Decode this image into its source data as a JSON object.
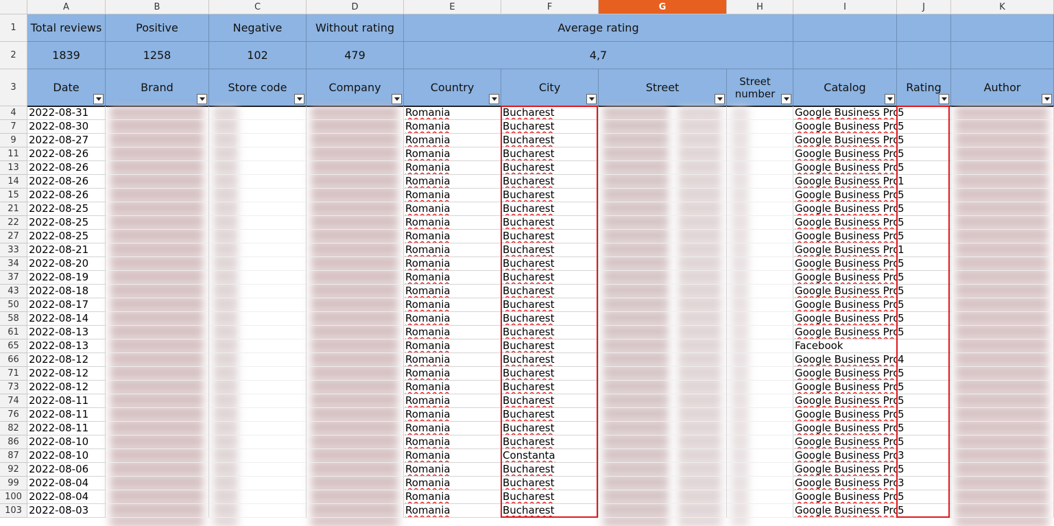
{
  "columns": [
    "A",
    "B",
    "C",
    "D",
    "E",
    "F",
    "G",
    "H",
    "I",
    "J",
    "K"
  ],
  "selected_column": "G",
  "summary_headers": {
    "total_reviews": "Total reviews",
    "positive": "Positive",
    "negative": "Negative",
    "without_rating": "Without rating",
    "average_rating": "Average rating"
  },
  "summary_values": {
    "total_reviews": "1839",
    "positive": "1258",
    "negative": "102",
    "without_rating": "479",
    "average_rating": "4,7"
  },
  "table_headers": {
    "date": "Date",
    "brand": "Brand",
    "store_code": "Store code",
    "company": "Company",
    "country": "Country",
    "city": "City",
    "street": "Street",
    "street_number": "Street number",
    "catalog": "Catalog",
    "rating": "Rating",
    "author": "Author"
  },
  "header_row_numbers": [
    "1",
    "2",
    "3"
  ],
  "rows": [
    {
      "row": "4",
      "date": "2022-08-31",
      "country": "Romania",
      "city": "Bucharest",
      "catalog": "Google Business Pro",
      "rating": "5"
    },
    {
      "row": "7",
      "date": "2022-08-30",
      "country": "Romania",
      "city": "Bucharest",
      "catalog": "Google Business Pro",
      "rating": "5"
    },
    {
      "row": "9",
      "date": "2022-08-27",
      "country": "Romania",
      "city": "Bucharest",
      "catalog": "Google Business Pro",
      "rating": "5"
    },
    {
      "row": "11",
      "date": "2022-08-26",
      "country": "Romania",
      "city": "Bucharest",
      "catalog": "Google Business Pro",
      "rating": "5"
    },
    {
      "row": "13",
      "date": "2022-08-26",
      "country": "Romania",
      "city": "Bucharest",
      "catalog": "Google Business Pro",
      "rating": "5"
    },
    {
      "row": "14",
      "date": "2022-08-26",
      "country": "Romania",
      "city": "Bucharest",
      "catalog": "Google Business Pro",
      "rating": "1"
    },
    {
      "row": "15",
      "date": "2022-08-26",
      "country": "Romania",
      "city": "Bucharest",
      "catalog": "Google Business Pro",
      "rating": "5"
    },
    {
      "row": "21",
      "date": "2022-08-25",
      "country": "Romania",
      "city": "Bucharest",
      "catalog": "Google Business Pro",
      "rating": "5"
    },
    {
      "row": "22",
      "date": "2022-08-25",
      "country": "Romania",
      "city": "Bucharest",
      "catalog": "Google Business Pro",
      "rating": "5"
    },
    {
      "row": "27",
      "date": "2022-08-25",
      "country": "Romania",
      "city": "Bucharest",
      "catalog": "Google Business Pro",
      "rating": "5"
    },
    {
      "row": "33",
      "date": "2022-08-21",
      "country": "Romania",
      "city": "Bucharest",
      "catalog": "Google Business Pro",
      "rating": "1"
    },
    {
      "row": "34",
      "date": "2022-08-20",
      "country": "Romania",
      "city": "Bucharest",
      "catalog": "Google Business Pro",
      "rating": "5"
    },
    {
      "row": "37",
      "date": "2022-08-19",
      "country": "Romania",
      "city": "Bucharest",
      "catalog": "Google Business Pro",
      "rating": "5"
    },
    {
      "row": "43",
      "date": "2022-08-18",
      "country": "Romania",
      "city": "Bucharest",
      "catalog": "Google Business Pro",
      "rating": "5"
    },
    {
      "row": "50",
      "date": "2022-08-17",
      "country": "Romania",
      "city": "Bucharest",
      "catalog": "Google Business Pro",
      "rating": "5"
    },
    {
      "row": "58",
      "date": "2022-08-14",
      "country": "Romania",
      "city": "Bucharest",
      "catalog": "Google Business Pro",
      "rating": "5"
    },
    {
      "row": "61",
      "date": "2022-08-13",
      "country": "Romania",
      "city": "Bucharest",
      "catalog": "Google Business Pro",
      "rating": "5"
    },
    {
      "row": "65",
      "date": "2022-08-13",
      "country": "Romania",
      "city": "Bucharest",
      "catalog": "Facebook",
      "rating": ""
    },
    {
      "row": "66",
      "date": "2022-08-12",
      "country": "Romania",
      "city": "Bucharest",
      "catalog": "Google Business Pro",
      "rating": "4"
    },
    {
      "row": "71",
      "date": "2022-08-12",
      "country": "Romania",
      "city": "Bucharest",
      "catalog": "Google Business Pro",
      "rating": "5"
    },
    {
      "row": "73",
      "date": "2022-08-12",
      "country": "Romania",
      "city": "Bucharest",
      "catalog": "Google Business Pro",
      "rating": "5"
    },
    {
      "row": "74",
      "date": "2022-08-11",
      "country": "Romania",
      "city": "Bucharest",
      "catalog": "Google Business Pro",
      "rating": "5"
    },
    {
      "row": "76",
      "date": "2022-08-11",
      "country": "Romania",
      "city": "Bucharest",
      "catalog": "Google Business Pro",
      "rating": "5"
    },
    {
      "row": "82",
      "date": "2022-08-11",
      "country": "Romania",
      "city": "Bucharest",
      "catalog": "Google Business Pro",
      "rating": "5"
    },
    {
      "row": "86",
      "date": "2022-08-10",
      "country": "Romania",
      "city": "Bucharest",
      "catalog": "Google Business Pro",
      "rating": "5"
    },
    {
      "row": "87",
      "date": "2022-08-10",
      "country": "Romania",
      "city": "Constanta",
      "catalog": "Google Business Pro",
      "rating": "3"
    },
    {
      "row": "92",
      "date": "2022-08-06",
      "country": "Romania",
      "city": "Bucharest",
      "catalog": "Google Business Pro",
      "rating": "5"
    },
    {
      "row": "99",
      "date": "2022-08-04",
      "country": "Romania",
      "city": "Bucharest",
      "catalog": "Google Business Pro",
      "rating": "3"
    },
    {
      "row": "100",
      "date": "2022-08-04",
      "country": "Romania",
      "city": "Bucharest",
      "catalog": "Google Business Pro",
      "rating": "5"
    },
    {
      "row": "103",
      "date": "2022-08-03",
      "country": "Romania",
      "city": "Bucharest",
      "catalog": "Google Business Pro",
      "rating": "5"
    }
  ],
  "colors": {
    "header_fill": "#8db4e2",
    "selected_column": "#e8601f",
    "highlight_box": "#e0161b"
  }
}
